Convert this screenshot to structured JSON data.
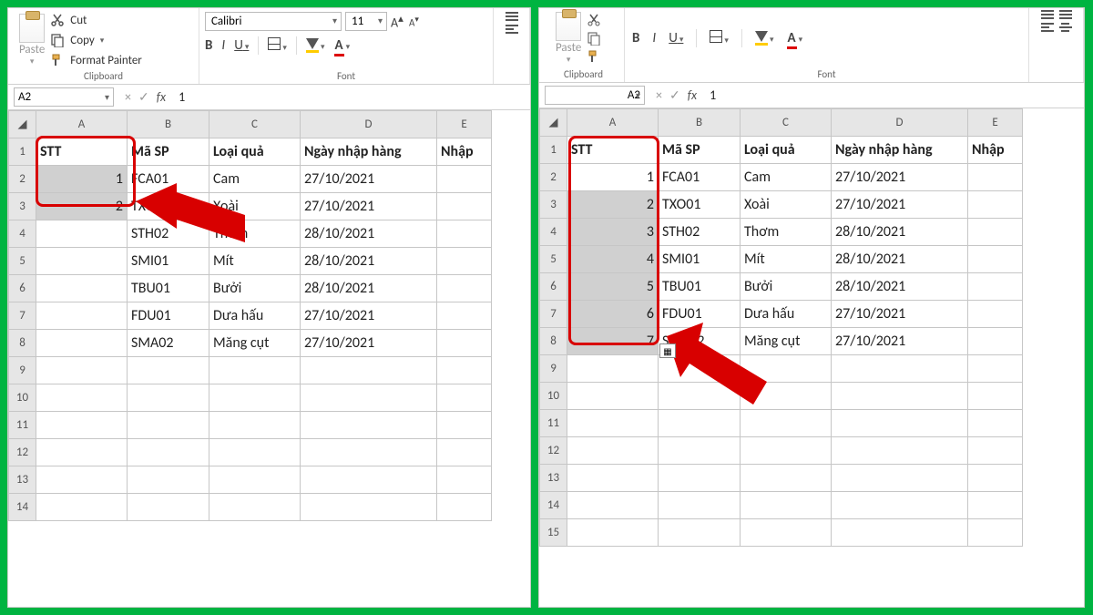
{
  "ribbon": {
    "paste_label": "Paste",
    "cut_label": "Cut",
    "copy_label": "Copy",
    "format_painter_label": "Format Painter",
    "clipboard_group": "Clipboard",
    "font_group": "Font",
    "font_name": "Calibri",
    "font_size": "11",
    "bold": "B",
    "italic": "I",
    "underline": "U",
    "grow_font": "A",
    "shrink_font": "A",
    "font_color_letter": "A"
  },
  "left": {
    "name_box": "A2",
    "formula_value": "1",
    "columns": [
      "A",
      "B",
      "C",
      "D"
    ],
    "headers": {
      "A": "STT",
      "B": "Mã SP",
      "C": "Loại quả",
      "D": "Ngày nhập hàng",
      "E": "Nhập"
    },
    "rows": [
      {
        "n": "1"
      },
      {
        "n": "2",
        "A": "1",
        "B": "FCA01",
        "C": "Cam",
        "D": "27/10/2021",
        "selA": true
      },
      {
        "n": "3",
        "A": "2",
        "B": "TXO01",
        "C": "Xoài",
        "D": "27/10/2021",
        "selA": true
      },
      {
        "n": "4",
        "A": "",
        "B": "STH02",
        "C": "Thơm",
        "D": "28/10/2021"
      },
      {
        "n": "5",
        "A": "",
        "B": "SMI01",
        "C": "Mít",
        "D": "28/10/2021"
      },
      {
        "n": "6",
        "A": "",
        "B": "TBU01",
        "C": "Bưởi",
        "D": "28/10/2021"
      },
      {
        "n": "7",
        "A": "",
        "B": "FDU01",
        "C": "Dưa hấu",
        "D": "27/10/2021"
      },
      {
        "n": "8",
        "A": "",
        "B": "SMA02",
        "C": "Măng cụt",
        "D": "27/10/2021"
      },
      {
        "n": "9"
      },
      {
        "n": "10"
      },
      {
        "n": "11"
      },
      {
        "n": "12"
      },
      {
        "n": "13"
      },
      {
        "n": "14"
      }
    ]
  },
  "right": {
    "name_box": "A2",
    "formula_value": "1",
    "columns": [
      "A",
      "B",
      "C",
      "D"
    ],
    "headers": {
      "A": "STT",
      "B": "Mã SP",
      "C": "Loại quả",
      "D": "Ngày nhập hàng",
      "E": "Nhập"
    },
    "rows": [
      {
        "n": "1"
      },
      {
        "n": "2",
        "A": "1",
        "B": "FCA01",
        "C": "Cam",
        "D": "27/10/2021",
        "selA": true,
        "white": true
      },
      {
        "n": "3",
        "A": "2",
        "B": "TXO01",
        "C": "Xoài",
        "D": "27/10/2021",
        "selA": true
      },
      {
        "n": "4",
        "A": "3",
        "B": "STH02",
        "C": "Thơm",
        "D": "28/10/2021",
        "selA": true
      },
      {
        "n": "5",
        "A": "4",
        "B": "SMI01",
        "C": "Mít",
        "D": "28/10/2021",
        "selA": true
      },
      {
        "n": "6",
        "A": "5",
        "B": "TBU01",
        "C": "Bưởi",
        "D": "28/10/2021",
        "selA": true
      },
      {
        "n": "7",
        "A": "6",
        "B": "FDU01",
        "C": "Dưa hấu",
        "D": "27/10/2021",
        "selA": true
      },
      {
        "n": "8",
        "A": "7",
        "B": "SMA02",
        "C": "Măng cụt",
        "D": "27/10/2021",
        "selA": true
      },
      {
        "n": "9"
      },
      {
        "n": "10"
      },
      {
        "n": "11"
      },
      {
        "n": "12"
      },
      {
        "n": "13"
      },
      {
        "n": "14"
      },
      {
        "n": "15"
      }
    ]
  },
  "fx_symbols": {
    "cancel": "×",
    "enter": "✓",
    "fx": "fx"
  }
}
